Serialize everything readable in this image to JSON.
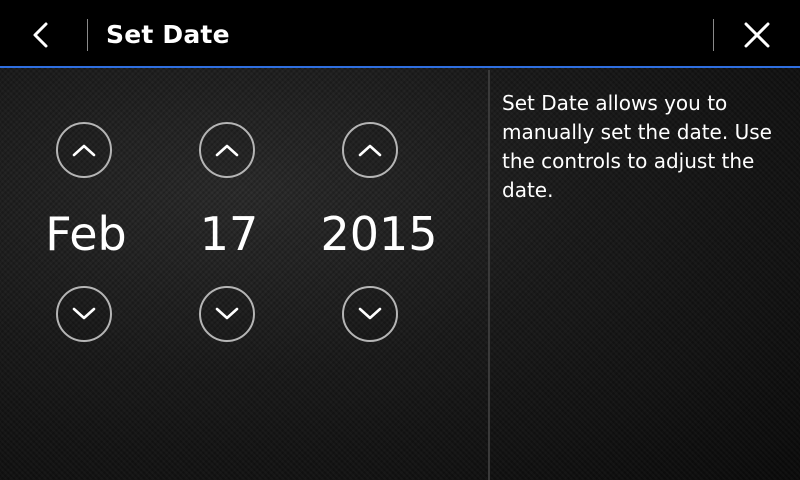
{
  "header": {
    "title": "Set Date",
    "back_icon": "chevron-left-icon",
    "close_icon": "close-icon",
    "accent_color": "#2f6fe0"
  },
  "date": {
    "month": "Feb",
    "day": "17",
    "year": "2015"
  },
  "controls": {
    "increment_icon": "chevron-up-icon",
    "decrement_icon": "chevron-down-icon"
  },
  "help": {
    "text": "Set Date allows you to manually set the date. Use the controls to adjust the date."
  }
}
